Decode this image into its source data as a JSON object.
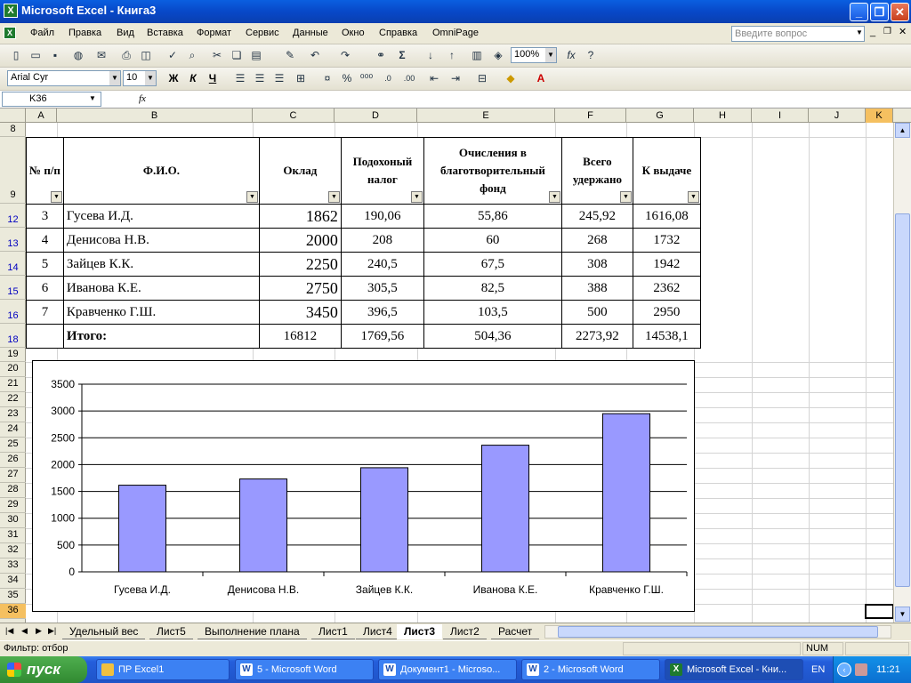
{
  "window": {
    "title": "Microsoft Excel - Книга3",
    "minimize": "_",
    "restore": "❐",
    "close": "✕"
  },
  "menu": {
    "items": [
      "Файл",
      "Правка",
      "Вид",
      "Вставка",
      "Формат",
      "Сервис",
      "Данные",
      "Окно",
      "Справка",
      "OmniPage"
    ],
    "ask_placeholder": "Введите вопрос"
  },
  "toolbar": {
    "zoom": "100%",
    "fx": "fx"
  },
  "format": {
    "font": "Arial Cyr",
    "size": "10",
    "bold": "Ж",
    "italic": "К",
    "underline": "Ч"
  },
  "formula": {
    "cell": "K36",
    "fx": "fx"
  },
  "columns": [
    "A",
    "B",
    "C",
    "D",
    "E",
    "F",
    "G",
    "H",
    "I",
    "J",
    "K"
  ],
  "rows": [
    "8",
    "9",
    "12",
    "13",
    "14",
    "15",
    "16",
    "18",
    "19",
    "20",
    "21",
    "22",
    "23",
    "24",
    "25",
    "26",
    "27",
    "28",
    "29",
    "30",
    "31",
    "32",
    "33",
    "34",
    "35",
    "36"
  ],
  "table": {
    "headers": [
      "№ п/п",
      "Ф.И.О.",
      "Оклад",
      "Подохоный налог",
      "Очисления в благотворительный фонд",
      "Всего удержано",
      "К выдаче"
    ],
    "rows": [
      [
        "3",
        "Гусева И.Д.",
        "1862",
        "190,06",
        "55,86",
        "245,92",
        "1616,08"
      ],
      [
        "4",
        "Денисова Н.В.",
        "2000",
        "208",
        "60",
        "268",
        "1732"
      ],
      [
        "5",
        "Зайцев К.К.",
        "2250",
        "240,5",
        "67,5",
        "308",
        "1942"
      ],
      [
        "6",
        "Иванова К.Е.",
        "2750",
        "305,5",
        "82,5",
        "388",
        "2362"
      ],
      [
        "7",
        "Кравченко Г.Ш.",
        "3450",
        "396,5",
        "103,5",
        "500",
        "2950"
      ]
    ],
    "total": [
      "",
      "Итого:",
      "16812",
      "1769,56",
      "504,36",
      "2273,92",
      "14538,1"
    ]
  },
  "chart_data": {
    "type": "bar",
    "categories": [
      "Гусева И.Д.",
      "Денисова Н.В.",
      "Зайцев К.К.",
      "Иванова К.Е.",
      "Кравченко Г.Ш."
    ],
    "values": [
      1616.08,
      1732,
      1942,
      2362,
      2950
    ],
    "yticks": [
      "0",
      "500",
      "1000",
      "1500",
      "2000",
      "2500",
      "3000",
      "3500"
    ],
    "ylim": [
      0,
      3500
    ],
    "grid": true,
    "bar_color": "#9999ff"
  },
  "sheets": {
    "tabs": [
      "Удельный вес",
      "Лист5",
      "Выполнение плана",
      "Лист1",
      "Лист4",
      "Лист3",
      "Лист2",
      "Расчет"
    ],
    "active": "Лист3"
  },
  "status": {
    "left": "Фильтр: отбор",
    "num": "NUM"
  },
  "taskbar": {
    "start": "пуск",
    "tasks": [
      "ПР Excel1",
      "5 - Microsoft Word",
      "Документ1 - Microso...",
      "2 - Microsoft Word",
      "Microsoft Excel - Кни..."
    ],
    "lang": "EN",
    "time": "11:21"
  }
}
